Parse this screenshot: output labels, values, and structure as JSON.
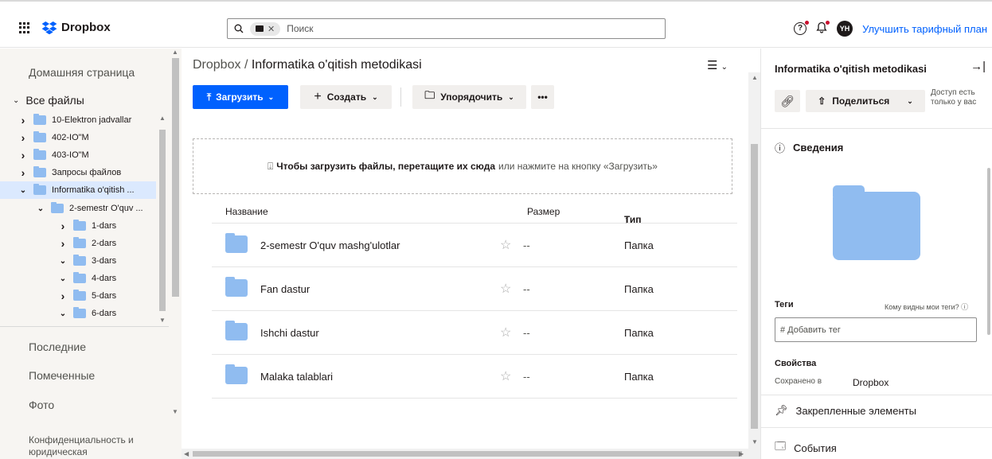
{
  "header": {
    "brand": "Dropbox",
    "search_placeholder": "Поиск",
    "upgrade_link": "Улучшить тарифный план",
    "avatar_initials": "YH"
  },
  "sidebar": {
    "home": "Домашняя страница",
    "all_files": "Все файлы",
    "tree": [
      {
        "label": "10-Elektron jadvallar",
        "expanded": false,
        "level": 0
      },
      {
        "label": "402-IO\"M",
        "expanded": false,
        "level": 0
      },
      {
        "label": "403-IO\"M",
        "expanded": false,
        "level": 0
      },
      {
        "label": "Запросы файлов",
        "expanded": false,
        "level": 0
      },
      {
        "label": "Informatika o'qitish ...",
        "expanded": true,
        "level": 0,
        "selected": true
      },
      {
        "label": "2-semestr O'quv ...",
        "expanded": true,
        "level": 1
      },
      {
        "label": "1-dars",
        "expanded": false,
        "level": 2
      },
      {
        "label": "2-dars",
        "expanded": false,
        "level": 2
      },
      {
        "label": "3-dars",
        "expanded": true,
        "level": 2
      },
      {
        "label": "4-dars",
        "expanded": true,
        "level": 2
      },
      {
        "label": "5-dars",
        "expanded": false,
        "level": 2
      },
      {
        "label": "6-dars",
        "expanded": true,
        "level": 2
      }
    ],
    "recent": "Последние",
    "starred": "Помеченные",
    "photos": "Фото",
    "privacy": "Конфиденциальность и",
    "legal": "юридическая"
  },
  "main": {
    "breadcrumb_root": "Dropbox",
    "breadcrumb_sep": "/",
    "breadcrumb_current": "Informatika o'qitish metodikasi",
    "upload_btn": "Загрузить",
    "create_btn": "Создать",
    "organize_btn": "Упорядочить",
    "more_btn": "•••",
    "dropzone_bold": "Чтобы загрузить файлы, перетащите их сюда",
    "dropzone_rest": "или нажмите на кнопку «Загрузить»",
    "columns": {
      "name": "Название",
      "size": "Размер",
      "type": "Тип"
    },
    "files": [
      {
        "name": "2-semestr O'quv mashg'ulotlar",
        "size": "--",
        "type": "Папка"
      },
      {
        "name": "Fan dastur",
        "size": "--",
        "type": "Папка"
      },
      {
        "name": "Ishchi dastur",
        "size": "--",
        "type": "Папка"
      },
      {
        "name": "Malaka talablari",
        "size": "--",
        "type": "Папка"
      }
    ]
  },
  "details": {
    "title": "Informatika o'qitish metodikasi",
    "share_btn": "Поделиться",
    "access_text": "Доступ есть только у вас",
    "info_heading": "Сведения",
    "tags_label": "Теги",
    "tags_who": "Кому видны мои теги?",
    "tag_placeholder": "# Добавить тег",
    "props_label": "Свойства",
    "saved_in_label": "Сохранено в",
    "saved_in_value": "Dropbox",
    "pinned": "Закрепленные элементы",
    "events": "События"
  }
}
